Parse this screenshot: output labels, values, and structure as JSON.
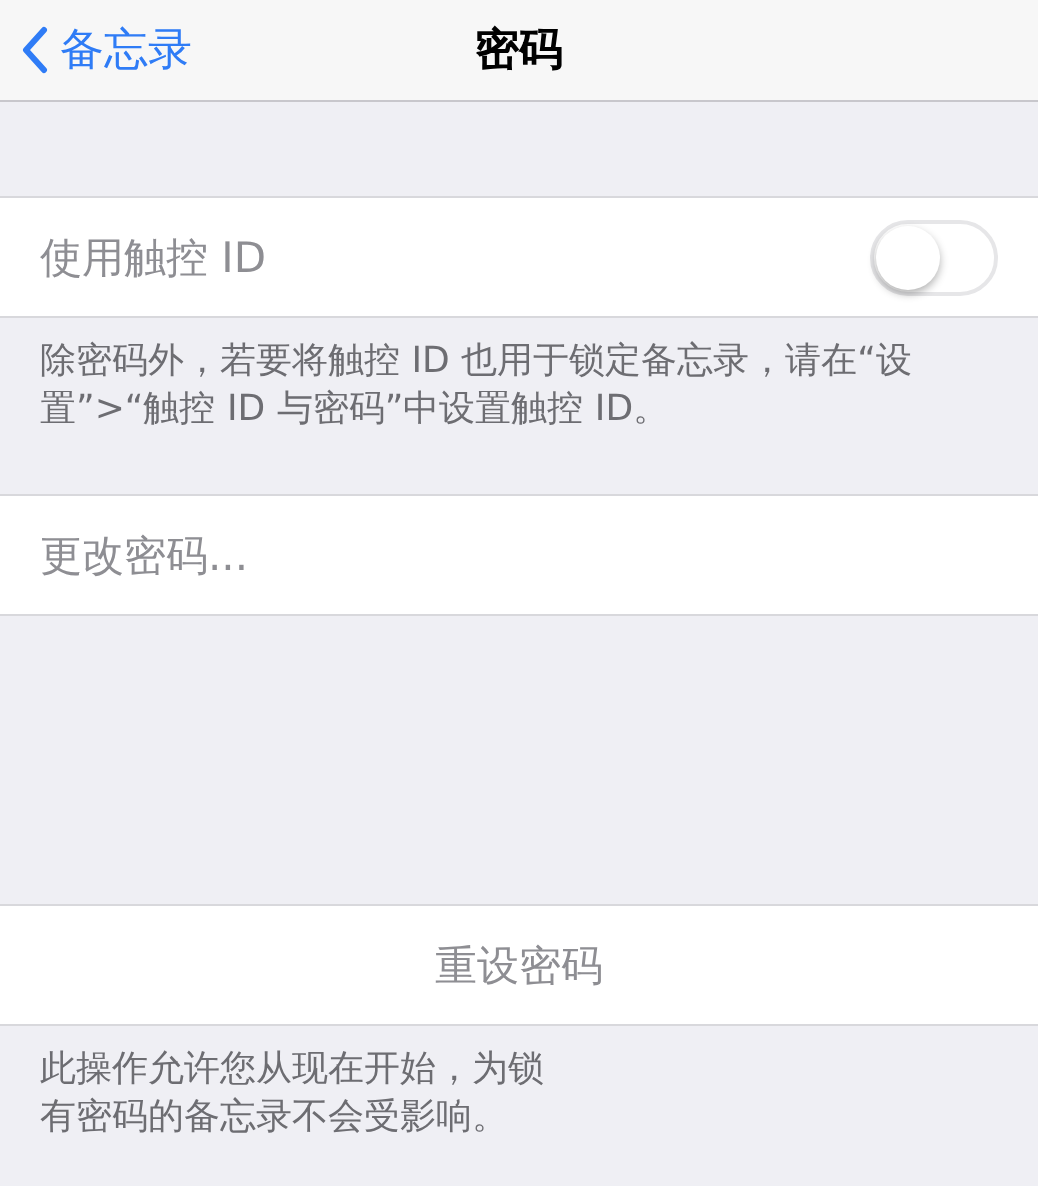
{
  "nav": {
    "back": "备忘录",
    "title": "密码"
  },
  "sections": [
    {
      "kind": "toggle",
      "label": "使用触控 ID",
      "on": false,
      "disabled": true,
      "footer": [
        "除密码外，若要将触控 ID 也用于锁定备忘录，请在“设置”>“触控 ID 与密码”中设置触控 ID。"
      ]
    },
    {
      "kind": "link",
      "label": "更改密码...",
      "disabled": true
    },
    {
      "kind": "action",
      "label": "重设密码",
      "disabled": true,
      "footer": [
        "此操作允许您从现在开始，为锁",
        "有密码的备忘录不会受影响。"
      ]
    }
  ]
}
